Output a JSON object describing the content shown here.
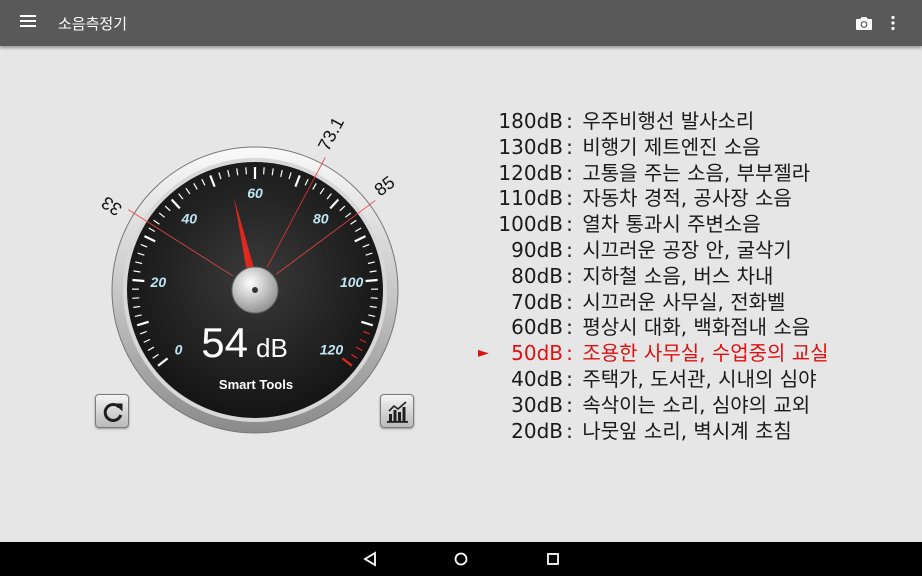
{
  "app": {
    "title": "소음측정기"
  },
  "icons": {
    "menu": "hamburger-menu-icon",
    "camera": "camera-icon",
    "more": "overflow-menu-icon",
    "reset": "refresh-icon",
    "chart": "bar-chart-icon",
    "back": "back-triangle-icon",
    "home": "home-circle-icon",
    "recents": "recents-square-icon"
  },
  "gauge": {
    "reading": "54",
    "unit": "dB",
    "brand": "Smart Tools",
    "needle_value": 54,
    "min_marker": "33",
    "avg_marker": "73.1",
    "max_marker": "85",
    "min_value": 33,
    "avg_value": 73.1,
    "max_value": 85,
    "scale_labels": [
      "0",
      "20",
      "40",
      "60",
      "80",
      "100",
      "120"
    ],
    "scale_min": 0,
    "scale_max": 120,
    "colors": {
      "face": "#2b2b2b",
      "ticks": "#ffffff",
      "labels": "#bfe6f2",
      "needle": "#e0281e",
      "red_zone": "#e0281e"
    }
  },
  "levels": [
    {
      "db": "180dB",
      "sep": ":",
      "desc": "우주비행선 발사소리"
    },
    {
      "db": "130dB",
      "sep": ":",
      "desc": "비행기 제트엔진 소음"
    },
    {
      "db": "120dB",
      "sep": ":",
      "desc": "고통을 주는 소음, 부부젤라"
    },
    {
      "db": "110dB",
      "sep": ":",
      "desc": "자동차 경적, 공사장 소음"
    },
    {
      "db": "100dB",
      "sep": ":",
      "desc": "열차 통과시 주변소음"
    },
    {
      "db": "90dB",
      "sep": ":",
      "desc": "시끄러운 공장 안, 굴삭기"
    },
    {
      "db": "80dB",
      "sep": ":",
      "desc": "지하철 소음, 버스 차내"
    },
    {
      "db": "70dB",
      "sep": ":",
      "desc": "시끄러운 사무실, 전화벨"
    },
    {
      "db": "60dB",
      "sep": ":",
      "desc": "평상시 대화, 백화점내 소음"
    },
    {
      "db": "50dB",
      "sep": ":",
      "desc": "조용한 사무실, 수업중의 교실",
      "current": true,
      "marker": "►"
    },
    {
      "db": "40dB",
      "sep": ":",
      "desc": "주택가, 도서관, 시내의 심야"
    },
    {
      "db": "30dB",
      "sep": ":",
      "desc": "속삭이는 소리, 심야의 교외"
    },
    {
      "db": "20dB",
      "sep": ":",
      "desc": "나뭇잎 소리, 벽시계 초침"
    }
  ]
}
